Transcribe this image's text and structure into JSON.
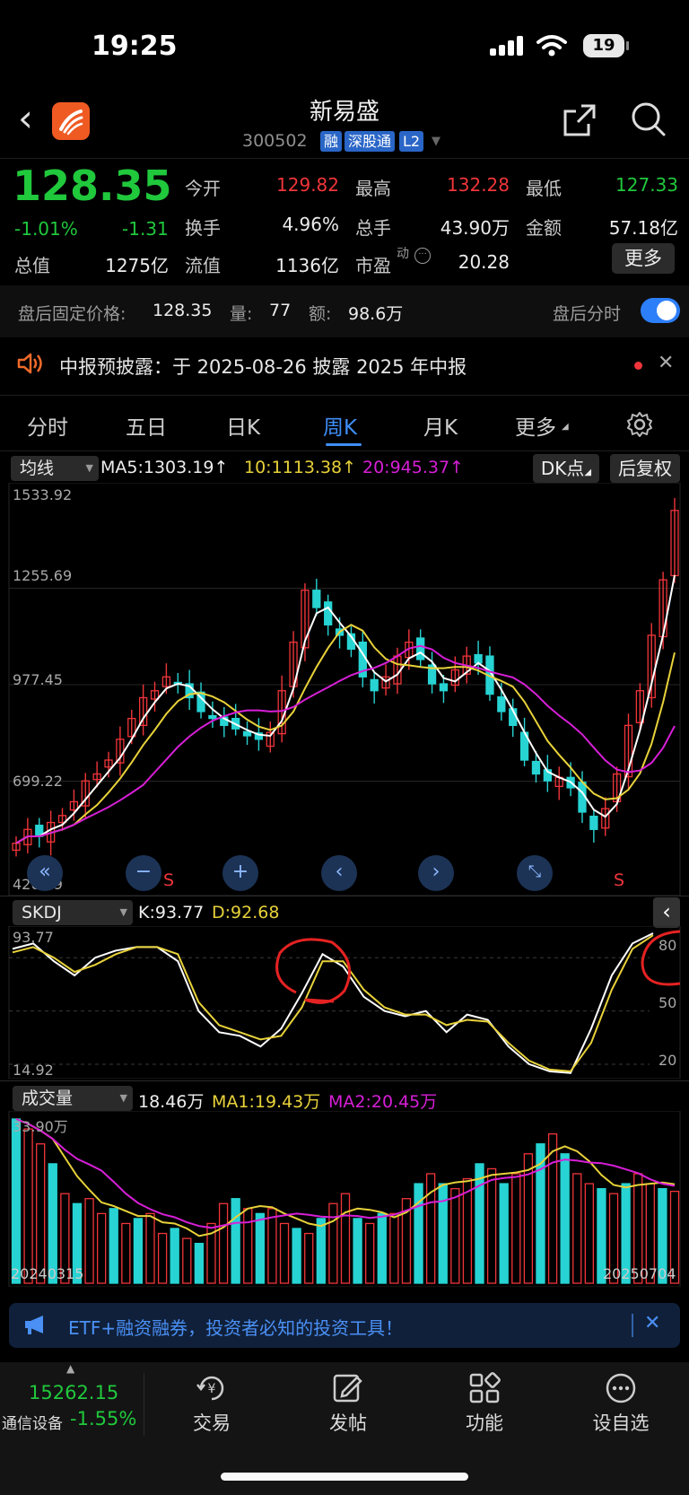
{
  "status_bar": {
    "time": "19:25",
    "battery": "19"
  },
  "header": {
    "stock_name": "新易盛",
    "stock_code": "300502",
    "tags": [
      "融",
      "深股通",
      "L2"
    ]
  },
  "quote": {
    "price": "128.35",
    "change_pct": "-1.01%",
    "change": "-1.31",
    "total_value_label": "总值",
    "total_value": "1275亿",
    "float_value_label": "流值",
    "float_value": "1136亿",
    "open_label": "今开",
    "open": "129.82",
    "turnover_label": "换手",
    "turnover": "4.96%",
    "high_label": "最高",
    "high": "132.28",
    "volume_label": "总手",
    "volume": "43.90万",
    "pe_label": "市盈",
    "pe_sup": "动",
    "pe": "20.28",
    "low_label": "最低",
    "low": "127.33",
    "amount_label": "金额",
    "amount": "57.18亿",
    "more_label": "更多"
  },
  "after_hours": {
    "label": "盘后固定价格:",
    "price": "128.35",
    "volume_label": "量:",
    "volume": "77",
    "amount_label": "额:",
    "amount": "98.6万",
    "toggle_label": "盘后分时",
    "toggle_on": true
  },
  "notice": {
    "text": "中报预披露：于 2025-08-26 披露 2025 年中报"
  },
  "tabs": [
    {
      "label": "分时"
    },
    {
      "label": "五日"
    },
    {
      "label": "日K"
    },
    {
      "label": "周K",
      "active": true
    },
    {
      "label": "月K"
    },
    {
      "label": "更多"
    }
  ],
  "main_chart_bar": {
    "indicator": "均线",
    "ma5": "MA5:1303.19↑",
    "ma10": "10:1113.38↑",
    "ma20": "20:945.37↑",
    "dk_label": "DK点",
    "fq_label": "后复权"
  },
  "main_axis": [
    "1533.92",
    "1255.69",
    "977.45",
    "699.22",
    "420.99"
  ],
  "sell_marks": [
    "S",
    "S"
  ],
  "skdj_bar": {
    "indicator": "SKDJ",
    "k": "K:93.77",
    "d": "D:92.68"
  },
  "skdj_axis": {
    "top": "93.77",
    "bottom": "14.92",
    "right": [
      "80",
      "50",
      "20"
    ]
  },
  "vol_bar": {
    "indicator": "成交量",
    "value": "18.46万",
    "ma1": "MA1:19.43万",
    "ma2": "MA2:20.45万",
    "axis_top": "33.90万"
  },
  "dates": {
    "start": "20240315",
    "end": "20250704"
  },
  "banner": {
    "text": "ETF+融资融券，投资者必知的投资工具！"
  },
  "bottom_nav": {
    "index_value": "15262.15",
    "index_name": "通信设备",
    "index_change": "-1.55%",
    "items": [
      {
        "label": "交易"
      },
      {
        "label": "发帖"
      },
      {
        "label": "功能"
      },
      {
        "label": "设自选"
      }
    ]
  },
  "colors": {
    "up": "#f0353a",
    "down": "#20c83c",
    "candle_down": "#27d3d3",
    "ma5": "#ffffff",
    "ma10": "#e8d23a",
    "ma20": "#d71fd7",
    "accent": "#3f8ff8"
  },
  "chart_data": [
    {
      "type": "candlestick",
      "title": "周K",
      "ylim": [
        420.99,
        1533.92
      ],
      "x": [
        "20240315",
        "20250704"
      ],
      "closes": [
        520,
        560,
        540,
        580,
        600,
        640,
        700,
        720,
        760,
        820,
        880,
        940,
        960,
        1000,
        980,
        940,
        900,
        880,
        860,
        850,
        830,
        820,
        840,
        960,
        1100,
        1250,
        1200,
        1150,
        1120,
        1080,
        1000,
        960,
        1000,
        1060,
        1100,
        1050,
        980,
        960,
        1020,
        1060,
        1040,
        950,
        900,
        860,
        760,
        720,
        700,
        710,
        680,
        610,
        560,
        620,
        720,
        860,
        960,
        1120,
        1280,
        1480
      ],
      "ma5": "1303.19",
      "ma10": "1113.38",
      "ma20": "945.37"
    },
    {
      "type": "line",
      "title": "SKDJ",
      "ylim": [
        14.92,
        93.77
      ],
      "series": [
        {
          "name": "K",
          "values": [
            85,
            88,
            78,
            70,
            80,
            84,
            86,
            86,
            78,
            50,
            38,
            36,
            30,
            40,
            60,
            82,
            75,
            58,
            50,
            47,
            50,
            38,
            48,
            45,
            30,
            20,
            16,
            15,
            40,
            70,
            88,
            93.77
          ]
        },
        {
          "name": "D",
          "values": [
            83,
            86,
            80,
            72,
            76,
            82,
            86,
            86,
            82,
            55,
            42,
            38,
            34,
            36,
            52,
            78,
            78,
            62,
            52,
            48,
            48,
            42,
            45,
            44,
            32,
            22,
            17,
            16,
            32,
            62,
            85,
            92.68
          ]
        }
      ]
    },
    {
      "type": "bar",
      "title": "成交量",
      "ylim": [
        0,
        33.9
      ],
      "values": [
        33,
        31,
        28,
        24,
        18,
        16,
        17,
        14,
        15,
        12,
        13,
        14,
        10,
        11,
        9,
        8,
        12,
        16,
        17,
        15,
        14,
        15,
        12,
        11,
        10,
        13,
        16,
        18,
        13,
        12,
        14,
        14,
        17,
        20,
        22,
        20,
        19,
        21,
        24,
        23,
        20,
        22,
        26,
        28,
        30,
        26,
        22,
        20,
        19,
        18,
        20,
        22,
        20,
        19,
        18.46
      ],
      "ma1": "19.43万",
      "ma2": "20.45万"
    }
  ]
}
